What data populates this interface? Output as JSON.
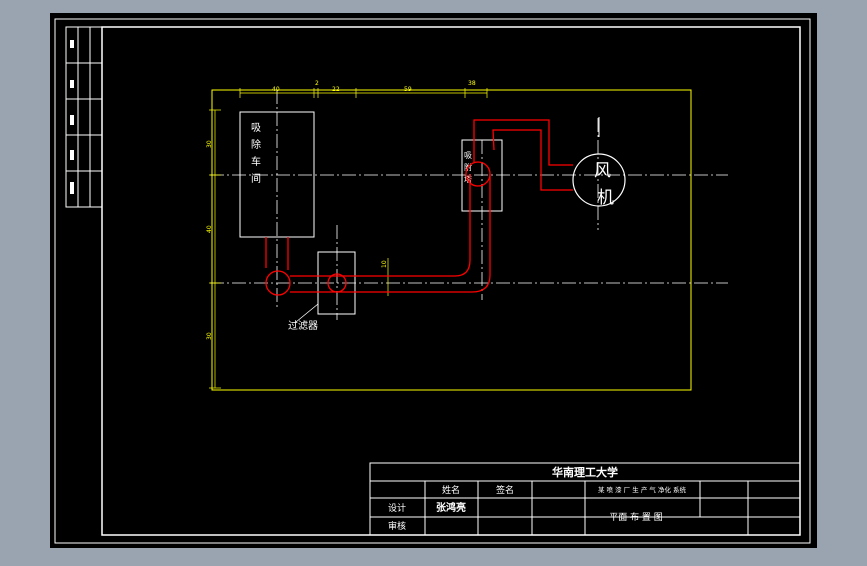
{
  "colors": {
    "frame": "#ffffff",
    "dimension": "#ffff00",
    "duct": "#ff0000",
    "outline": "#ffffff",
    "canvas": "#000000"
  },
  "labels": {
    "workshop": [
      "吸",
      "除",
      "车",
      "间"
    ],
    "adsorber": [
      "吸",
      "附",
      "塔"
    ],
    "fan": [
      "风",
      "机"
    ],
    "filter": "过滤器"
  },
  "dimensions": {
    "top": [
      "40",
      "2",
      "22",
      "59",
      "38"
    ],
    "left": [
      "30",
      "40",
      "30"
    ],
    "filter_gap": "10"
  },
  "title_block": {
    "school": "华南理工大学",
    "col_name": "姓名",
    "col_sign": "签名",
    "project": "某 喷 漆 厂 生 产 气 净化 系统",
    "row_design": "设计",
    "row_review": "审核",
    "designer": "张鸿亮",
    "drawing_title": "平面 布 置 图"
  }
}
